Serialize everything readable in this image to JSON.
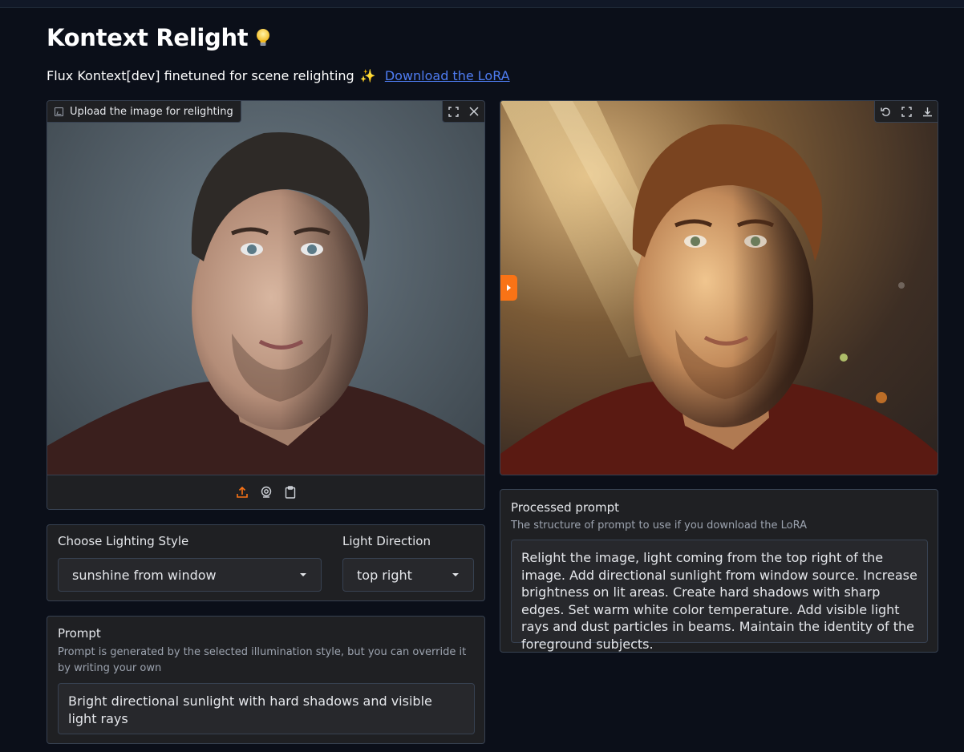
{
  "header": {
    "title": "Kontext Relight",
    "subtitle_prefix": "Flux Kontext[dev] finetuned for scene relighting",
    "subtitle_emoji": "✨",
    "lora_link": "Download the LoRA"
  },
  "input_image": {
    "label": "Upload the image for relighting"
  },
  "controls": {
    "lighting_style_label": "Choose Lighting Style",
    "lighting_style_value": "sunshine from window",
    "light_direction_label": "Light Direction",
    "light_direction_value": "top right"
  },
  "prompt": {
    "label": "Prompt",
    "info": "Prompt is generated by the selected illumination style, but you can override it by writing your own",
    "value": "Bright directional sunlight with hard shadows and visible light rays"
  },
  "processed": {
    "label": "Processed prompt",
    "info": "The structure of prompt to use if you download the LoRA",
    "value": "Relight the image, light coming from the top right of the image. Add directional sunlight from window source. Increase brightness on lit areas. Create hard shadows with sharp edges. Set warm white color temperature. Add visible light rays and dust particles in beams. Maintain the identity of the foreground subjects."
  },
  "colors": {
    "background": "#0b0f19",
    "panel": "#1f2023",
    "accent": "#f97316",
    "link": "#4f7df3"
  },
  "icons": {
    "title_emoji": "light-bulb-icon",
    "upload": "upload-icon",
    "webcam": "webcam-icon",
    "clipboard": "clipboard-icon",
    "fullscreen": "fullscreen-icon",
    "close": "close-icon",
    "undo": "undo-icon",
    "download": "download-icon"
  }
}
